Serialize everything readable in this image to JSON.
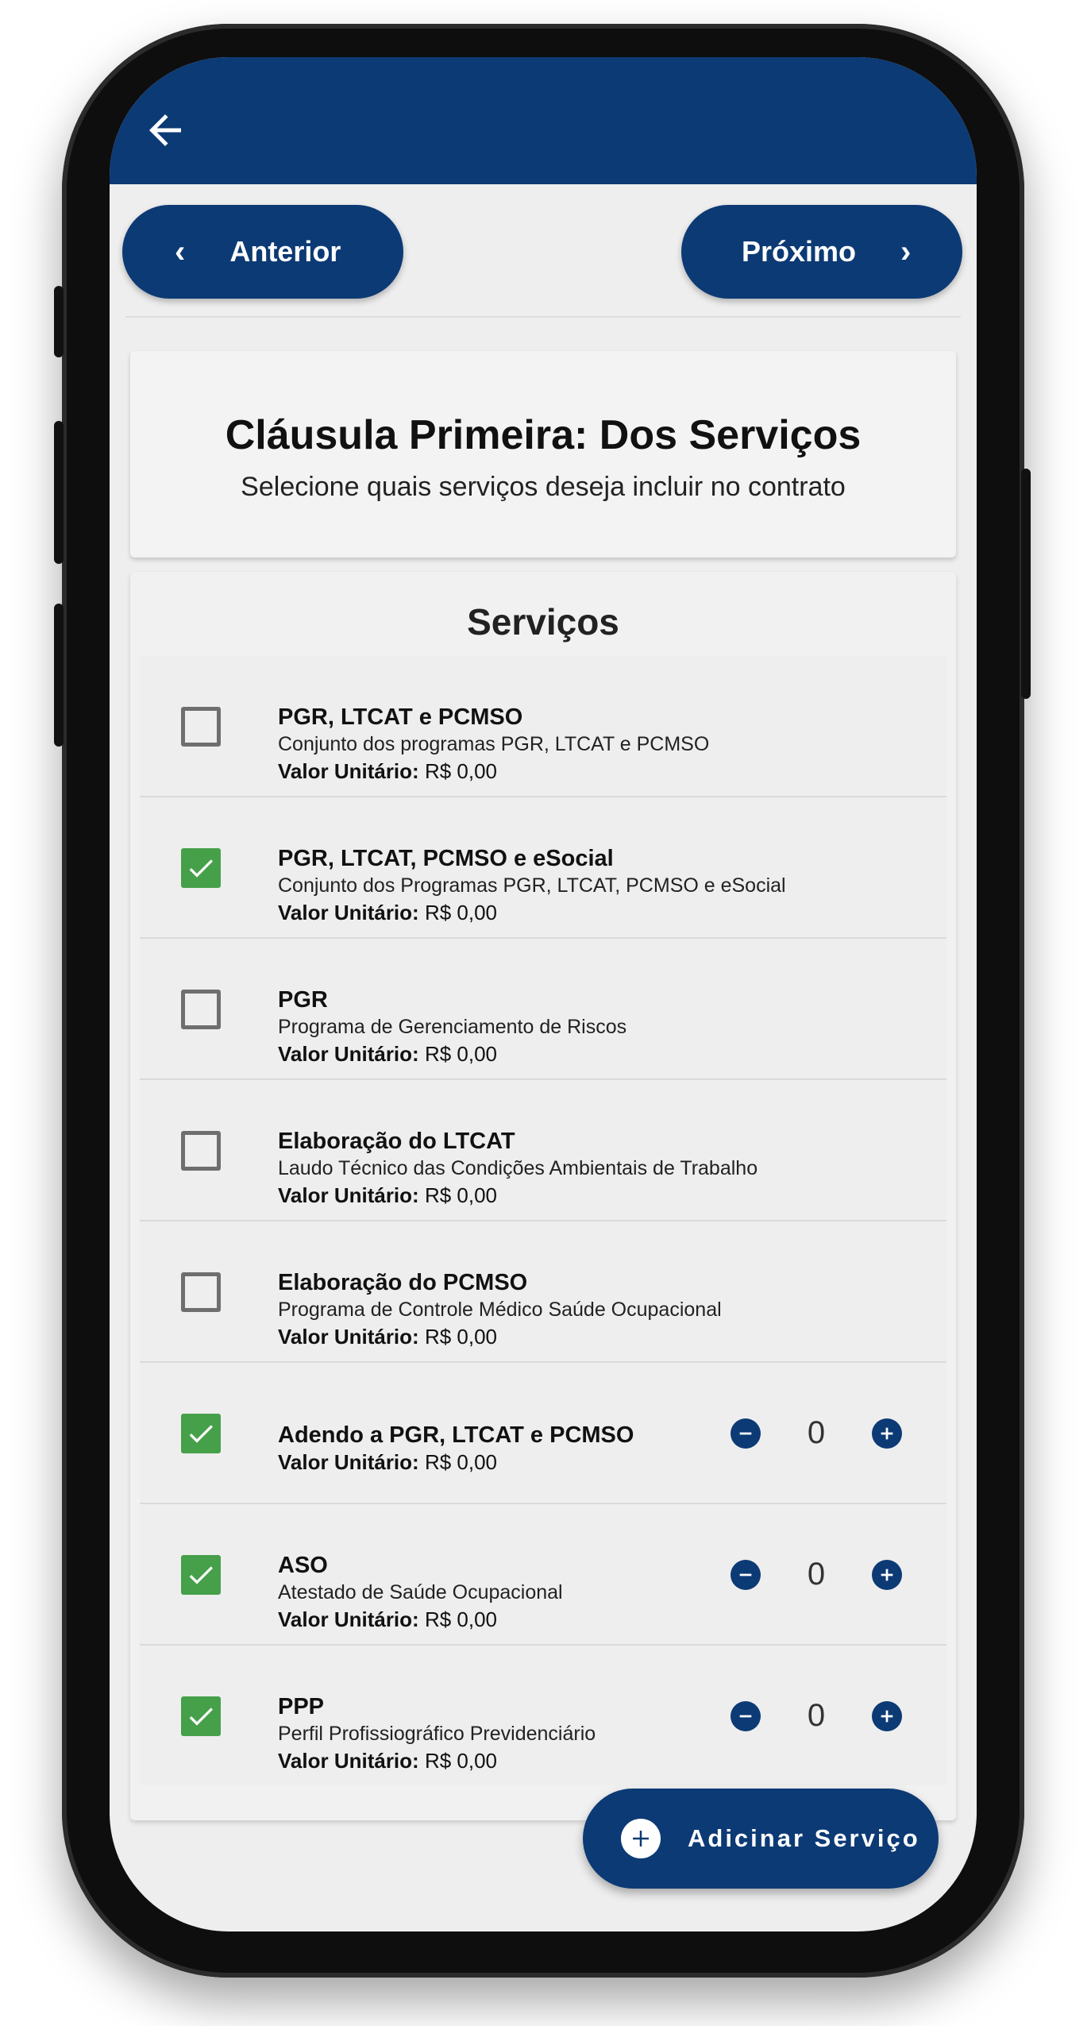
{
  "nav": {
    "prev_label": "Anterior",
    "next_label": "Próximo"
  },
  "clause": {
    "title": "Cláusula Primeira: Dos Serviços",
    "subtitle": "Selecione quais serviços deseja incluir no contrato"
  },
  "services": {
    "title": "Serviços",
    "price_label": "Valor Unitário:",
    "items": [
      {
        "name": "PGR, LTCAT e PCMSO",
        "description": "Conjunto dos programas PGR, LTCAT e PCMSO",
        "price": "R$ 0,00",
        "checked": false
      },
      {
        "name": "PGR, LTCAT, PCMSO e eSocial",
        "description": "Conjunto dos Programas PGR, LTCAT, PCMSO e eSocial",
        "price": "R$ 0,00",
        "checked": true
      },
      {
        "name": "PGR",
        "description": "Programa de Gerenciamento de Riscos",
        "price": "R$ 0,00",
        "checked": false
      },
      {
        "name": "Elaboração do LTCAT",
        "description": "Laudo Técnico das Condições Ambientais de Trabalho",
        "price": "R$ 0,00",
        "checked": false
      },
      {
        "name": "Elaboração do PCMSO",
        "description": "Programa de Controle Médico Saúde Ocupacional",
        "price": "R$ 0,00",
        "checked": false
      },
      {
        "name": "Adendo a PGR, LTCAT e PCMSO",
        "price": "R$ 0,00",
        "checked": true,
        "quantity": "0"
      },
      {
        "name": "ASO",
        "description": "Atestado de Saúde Ocupacional",
        "price": "R$ 0,00",
        "checked": true,
        "quantity": "0"
      },
      {
        "name": "PPP",
        "description": "Perfil Profissiográfico Previdenciário",
        "price": "R$ 0,00",
        "checked": true,
        "quantity": "0"
      }
    ]
  },
  "fab": {
    "label": "Adicinar Serviço"
  },
  "colors": {
    "primary": "#0c3a75",
    "check_green": "#45a049",
    "background": "#eeeeee"
  },
  "icons": {
    "back": "arrow-left-icon",
    "prev": "chevron-left-icon",
    "next": "chevron-right-icon",
    "check": "check-icon",
    "minus": "minus-circle-icon",
    "plus": "plus-circle-icon",
    "add": "add-circle-icon"
  }
}
